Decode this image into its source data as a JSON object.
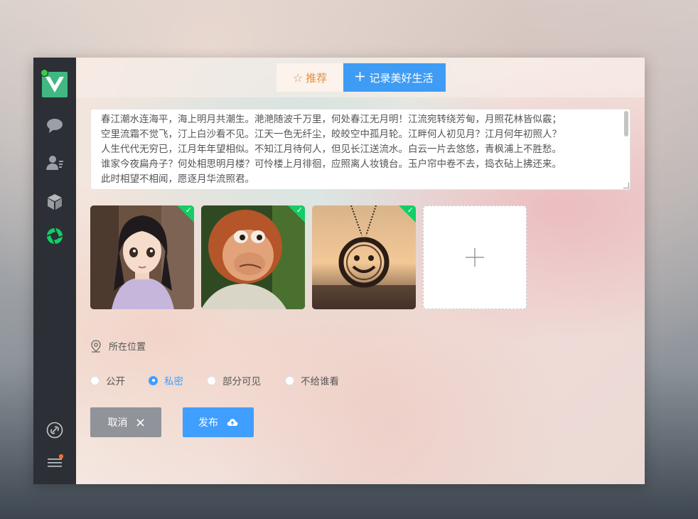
{
  "tabs": {
    "recommend_label": "推荐",
    "record_label": "记录美好生活"
  },
  "editor": {
    "content": "春江潮水连海平，海上明月共潮生。滟滟随波千万里，何处春江无月明！江流宛转绕芳甸，月照花林皆似霰；\n空里流霜不觉飞，汀上白沙看不见。江天一色无纤尘，皎皎空中孤月轮。江畔何人初见月？江月何年初照人？\n人生代代无穷已，江月年年望相似。不知江月待何人，但见长江送流水。白云一片去悠悠，青枫浦上不胜愁。\n谁家今夜扁舟子？何处相思明月楼？可怜楼上月徘徊，应照离人妆镜台。玉户帘中卷不去，捣衣砧上拂还来。\n此时相望不相闻，愿逐月华流照君。"
  },
  "photos": [
    {
      "icon": "animated-girl-portrait",
      "selected": true
    },
    {
      "icon": "monkey-king-portrait",
      "selected": true
    },
    {
      "icon": "smiley-pendant-photo",
      "selected": true
    }
  ],
  "upload": {
    "icon": "plus-icon"
  },
  "location": {
    "label": "所在位置"
  },
  "visibility": {
    "options": [
      "公开",
      "私密",
      "部分可见",
      "不给谁看"
    ],
    "selected": "私密"
  },
  "actions": {
    "cancel_label": "取消",
    "publish_label": "发布"
  },
  "colors": {
    "primary": "#409eff",
    "orange": "#e88d3a",
    "success": "#13ce66",
    "sidebar": "#2c2f35",
    "cancel": "#909399"
  }
}
